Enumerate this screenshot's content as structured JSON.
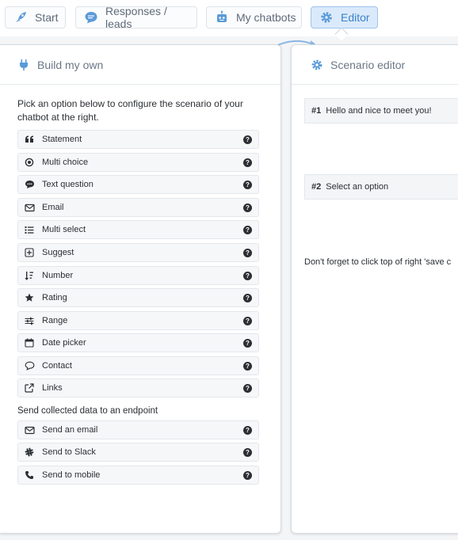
{
  "nav": {
    "tabs": [
      {
        "label": "Start",
        "icon": "rocket-icon"
      },
      {
        "label": "Responses / leads",
        "icon": "chat-bubble-icon"
      },
      {
        "label": "My chatbots",
        "icon": "robot-icon"
      },
      {
        "label": "Editor",
        "icon": "gear-icon",
        "active": true
      }
    ]
  },
  "left_panel": {
    "title": "Build my own",
    "intro": "Pick an option below to configure the scenario of your chatbot at the right.",
    "options": [
      {
        "label": "Statement",
        "icon": "quote-icon"
      },
      {
        "label": "Multi choice",
        "icon": "radio-dot-icon"
      },
      {
        "label": "Text question",
        "icon": "speech-bubble-icon"
      },
      {
        "label": "Email",
        "icon": "envelope-icon"
      },
      {
        "label": "Multi select",
        "icon": "list-icon"
      },
      {
        "label": "Suggest",
        "icon": "plus-square-icon"
      },
      {
        "label": "Number",
        "icon": "sort-numeric-icon"
      },
      {
        "label": "Rating",
        "icon": "star-icon"
      },
      {
        "label": "Range",
        "icon": "sliders-icon"
      },
      {
        "label": "Date picker",
        "icon": "calendar-icon"
      },
      {
        "label": "Contact",
        "icon": "comment-outline-icon"
      },
      {
        "label": "Links",
        "icon": "external-link-icon"
      }
    ],
    "endpoint_label": "Send collected data to an endpoint",
    "endpoints": [
      {
        "label": "Send an email",
        "icon": "envelope-icon"
      },
      {
        "label": "Send to Slack",
        "icon": "slack-icon"
      },
      {
        "label": "Send to mobile",
        "icon": "phone-icon"
      }
    ],
    "help_glyph": "?"
  },
  "right_panel": {
    "title": "Scenario editor",
    "steps": [
      {
        "num": "#1",
        "text": "Hello and nice to meet you!"
      },
      {
        "num": "#2",
        "text": "Select an option"
      }
    ],
    "reminder": "Don't forget to click top of right 'save c"
  },
  "colors": {
    "accent": "#3b82c9",
    "active_tab_bg": "#dbeafb",
    "icon_blue": "#5b9bd8"
  }
}
